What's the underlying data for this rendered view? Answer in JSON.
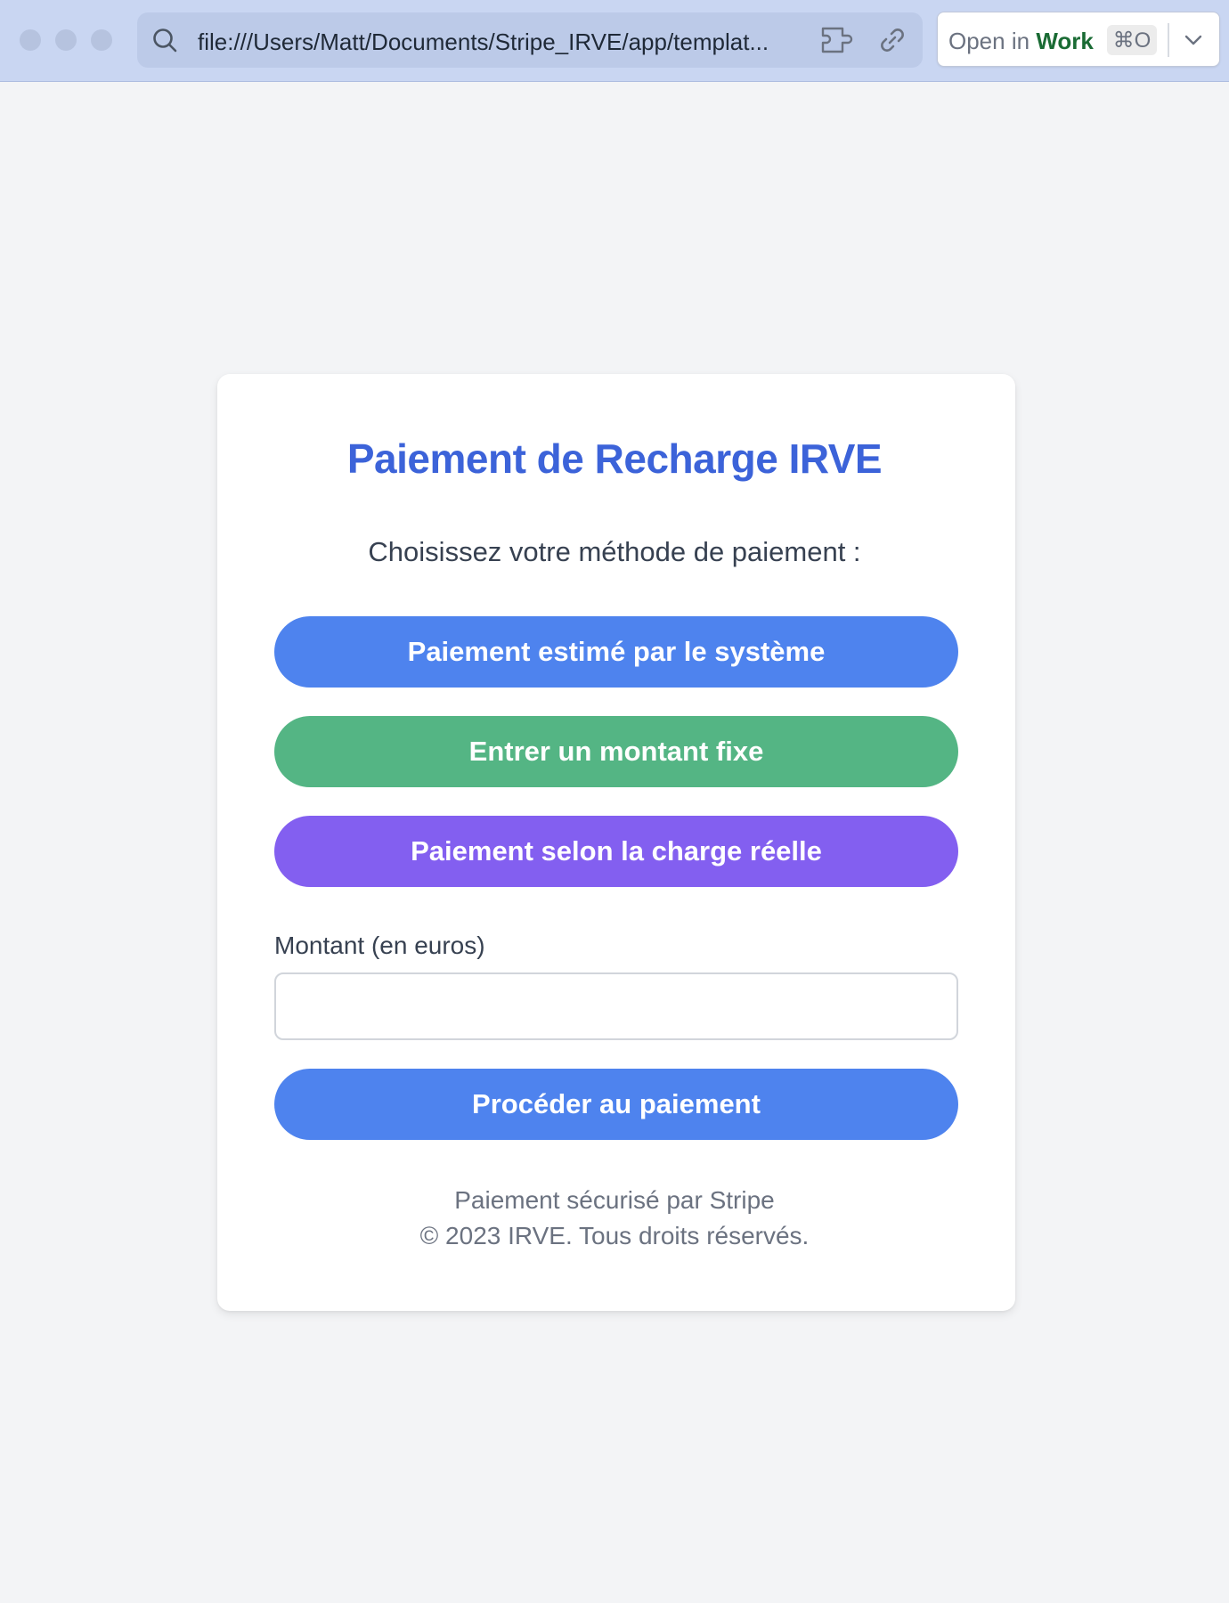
{
  "browser": {
    "url": "file:///Users/Matt/Documents/Stripe_IRVE/app/templat...",
    "open_in_prefix": "Open in",
    "open_in_brand": "Work",
    "shortcut": "⌘O"
  },
  "page": {
    "title": "Paiement de Recharge IRVE",
    "subtitle": "Choisissez votre méthode de paiement :",
    "buttons": {
      "estimated": "Paiement estimé par le système",
      "fixed": "Entrer un montant fixe",
      "actual": "Paiement selon la charge réelle"
    },
    "amount_label": "Montant (en euros)",
    "amount_value": "",
    "submit_label": "Procéder au paiement",
    "footer_line1": "Paiement sécurisé par Stripe",
    "footer_line2": "© 2023 IRVE. Tous droits réservés."
  },
  "colors": {
    "title": "#3c63d9",
    "button_blue": "#4e83ee",
    "button_green": "#54b584",
    "button_purple": "#835ff0",
    "background": "#f3f4f6",
    "brand_green": "#1a6b34"
  },
  "icons": {
    "url_search": "search-icon",
    "extension": "extension-icon",
    "link": "link-icon",
    "dropdown": "chevron-down-icon"
  }
}
